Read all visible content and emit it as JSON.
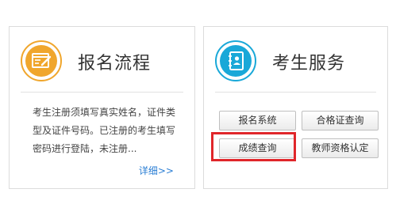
{
  "registration": {
    "title": "报名流程",
    "icon": "registration-form-icon",
    "description": "考生注册须填写真实姓名，证件类型及证件号码。已注册的考生填写密码进行登陆，未注册...",
    "more_link": "详细>>",
    "accent_color": "#f0a62c"
  },
  "services": {
    "title": "考生服务",
    "icon": "contact-book-icon",
    "accent_color": "#19a8d8",
    "buttons": [
      {
        "label": "报名系统"
      },
      {
        "label": "合格证查询"
      },
      {
        "label": "成绩查询"
      },
      {
        "label": "教师资格认定"
      }
    ],
    "highlight_color": "#e0262a"
  }
}
